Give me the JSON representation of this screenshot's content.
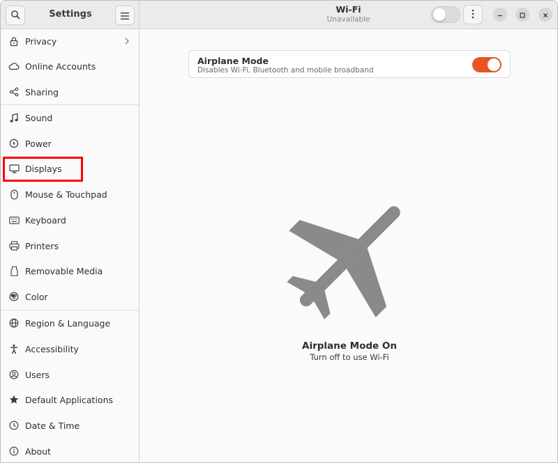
{
  "sidebar_header": {
    "title": "Settings",
    "search_icon": "search-icon",
    "menu_icon": "hamburger-menu-icon"
  },
  "main_header": {
    "title": "Wi-Fi",
    "subtitle": "Unavailable",
    "wifi_switch_state": "off"
  },
  "sidebar": {
    "items": [
      {
        "label": "Privacy",
        "icon": "lock-icon",
        "has_chevron": true
      },
      {
        "label": "Online Accounts",
        "icon": "cloud-icon"
      },
      {
        "label": "Sharing",
        "icon": "share-icon"
      },
      {
        "label": "Sound",
        "icon": "music-note-icon"
      },
      {
        "label": "Power",
        "icon": "power-icon"
      },
      {
        "label": "Displays",
        "icon": "display-icon"
      },
      {
        "label": "Mouse & Touchpad",
        "icon": "mouse-icon"
      },
      {
        "label": "Keyboard",
        "icon": "keyboard-icon"
      },
      {
        "label": "Printers",
        "icon": "printer-icon"
      },
      {
        "label": "Removable Media",
        "icon": "removable-media-icon"
      },
      {
        "label": "Color",
        "icon": "color-icon"
      },
      {
        "label": "Region & Language",
        "icon": "globe-icon"
      },
      {
        "label": "Accessibility",
        "icon": "accessibility-icon"
      },
      {
        "label": "Users",
        "icon": "users-icon"
      },
      {
        "label": "Default Applications",
        "icon": "star-icon"
      },
      {
        "label": "Date & Time",
        "icon": "clock-icon"
      },
      {
        "label": "About",
        "icon": "info-icon"
      }
    ]
  },
  "airplane_card": {
    "title": "Airplane Mode",
    "subtitle": "Disables Wi-Fi, Bluetooth and mobile broadband",
    "switch_state": "on"
  },
  "empty_state": {
    "icon": "airplane-icon",
    "title": "Airplane Mode On",
    "subtitle": "Turn off to use Wi-Fi"
  },
  "colors": {
    "accent": "#e95420",
    "highlight_box": "#ff0000",
    "airplane_icon": "#8a8a8a"
  }
}
